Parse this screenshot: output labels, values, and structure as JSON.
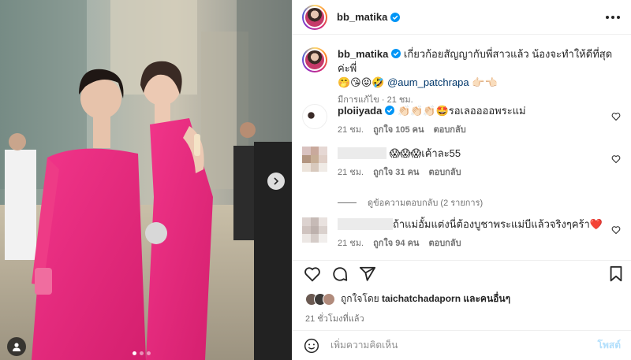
{
  "photo": {
    "alt": "photo",
    "carousel_total": 3,
    "carousel_current": 1
  },
  "post": {
    "username": "bb_matika",
    "caption": {
      "username": "bb_matika",
      "text": " เกี่ยวก้อยสัญญากับพี่สาวแล้ว น้องจะทำให้ดีที่สุดค่ะพี่",
      "emojis": "🤭😘😝🤣",
      "mention": "@aum_patchrapa",
      "tail": " 👉🏻👈🏻",
      "edited": "มีการแก้ไข",
      "time": "21 ชม."
    },
    "comments": [
      {
        "username": "ploiiyada",
        "verified": true,
        "text": " 👏🏻👏🏻👏🏻🤩รอเลออออพระแม่",
        "time": "21 ชม.",
        "likes": "ถูกใจ 105 คน",
        "reply": "ตอบกลับ"
      },
      {
        "username": "",
        "verified": false,
        "text": "😱😱😱เค้าละ55",
        "time": "21 ชม.",
        "likes": "ถูกใจ 31 คน",
        "reply": "ตอบกลับ"
      },
      {
        "username": "",
        "verified": false,
        "text": "ถ้าแม่อั้มแต่งนี่ต้องบูชาพระแม่บีแล้วจริงๆคร้า❤️",
        "time": "21 ชม.",
        "likes": "ถูกใจ 94 คน",
        "reply": "ตอบกลับ"
      }
    ],
    "view_replies": "ดูข้อความตอบกลับ (2 รายการ)",
    "liked_by_prefix": "ถูกใจโดย ",
    "liked_by_user": "taichatchadaporn",
    "liked_by_suffix": " และคนอื่นๆ",
    "posted_ago": "21 ชั่วโมงที่แล้ว",
    "add_comment_placeholder": "เพิ่มความคิดเห็น",
    "post_label": "โพสต์"
  },
  "icons": {
    "verified": "verified-badge-icon",
    "more": "more-options-icon",
    "heart": "heart-icon",
    "comment": "comment-icon",
    "share": "share-icon",
    "save": "bookmark-icon",
    "emoji": "emoji-icon",
    "next": "chevron-right-icon",
    "user_tag": "user-tag-icon"
  },
  "colors": {
    "verified": "#0095f6",
    "mention": "#00376b",
    "muted": "#737373",
    "post_disabled": "#b2dffc",
    "dress": "#e8287a"
  }
}
